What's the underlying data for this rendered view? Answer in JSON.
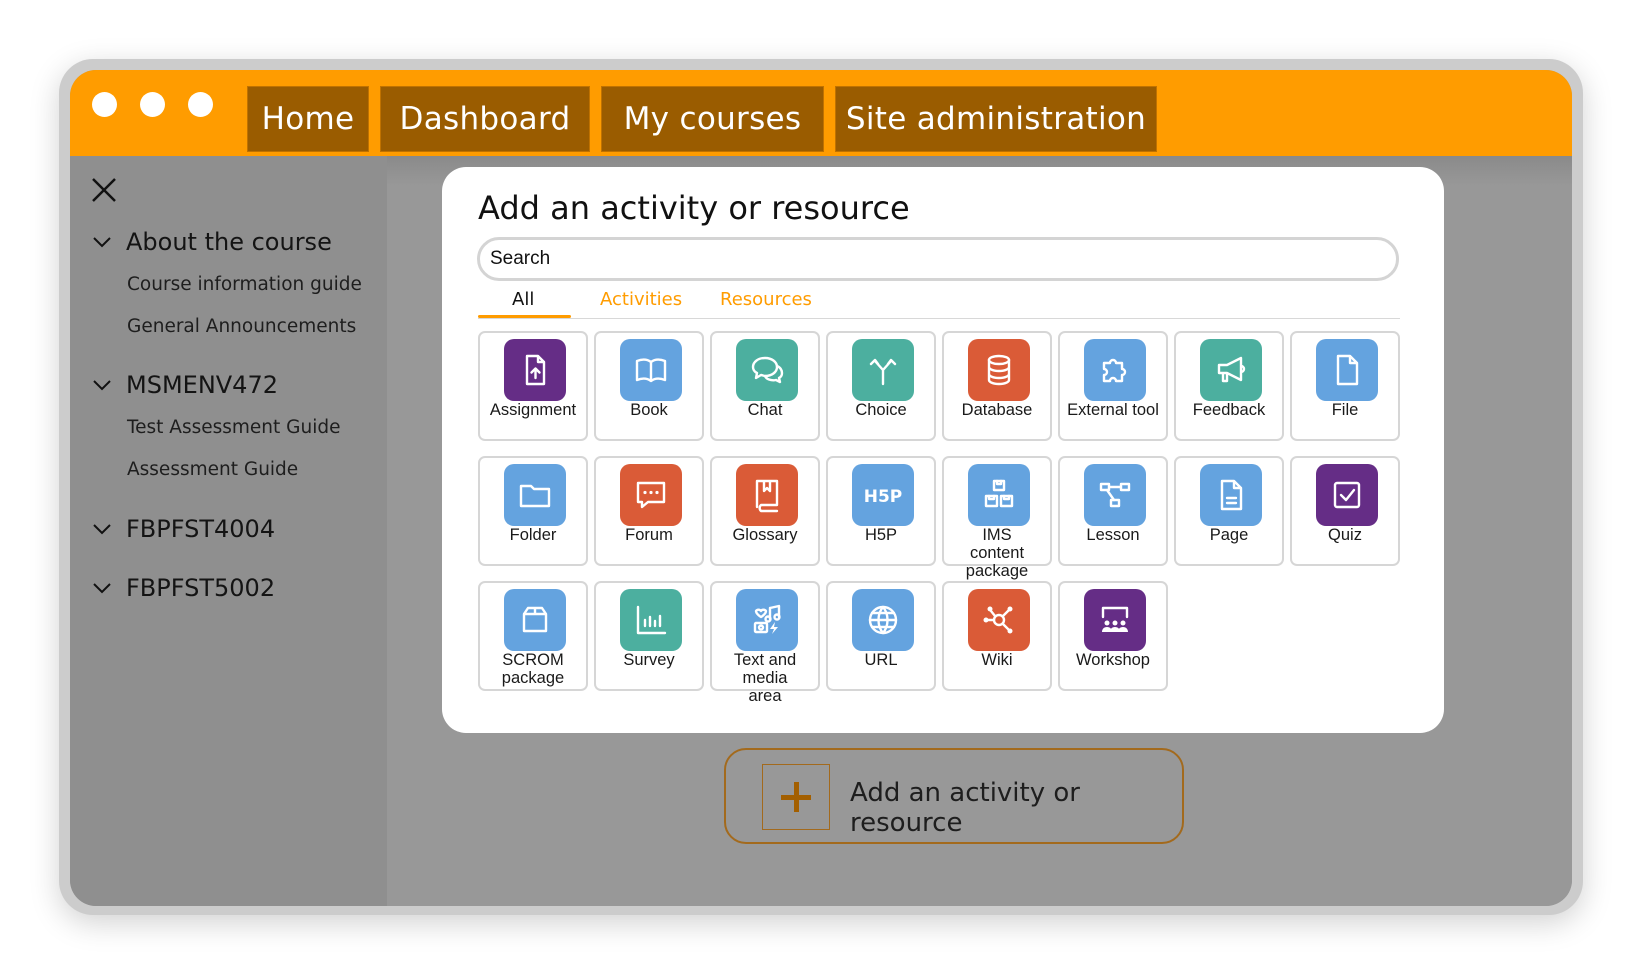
{
  "window": {
    "nav_tabs": [
      {
        "label": "Home"
      },
      {
        "label": "Dashboard"
      },
      {
        "label": "My courses"
      },
      {
        "label": "Site administration"
      }
    ]
  },
  "sidebar": {
    "close_icon": "close-icon",
    "sections": [
      {
        "title": "About the course",
        "items": [
          "Course information guide",
          "General Announcements"
        ]
      },
      {
        "title": "MSMENV472",
        "items": [
          "Test Assessment Guide",
          "Assessment Guide"
        ]
      },
      {
        "title": "FBPFST4004",
        "items": []
      },
      {
        "title": "FBPFST5002",
        "items": []
      }
    ]
  },
  "modal": {
    "title": "Add an activity or resource",
    "search_placeholder": "Search",
    "search_value": "",
    "tabs": [
      {
        "label": "All",
        "active": true
      },
      {
        "label": "Activities",
        "active": false
      },
      {
        "label": "Resources",
        "active": false
      }
    ],
    "items": [
      {
        "label": "Assignment",
        "icon": "assignment-icon",
        "color": "#652d86"
      },
      {
        "label": "Book",
        "icon": "book-icon",
        "color": "#64a3df"
      },
      {
        "label": "Chat",
        "icon": "chat-icon",
        "color": "#4caf9f"
      },
      {
        "label": "Choice",
        "icon": "choice-icon",
        "color": "#4caf9f"
      },
      {
        "label": "Database",
        "icon": "database-icon",
        "color": "#da5b37"
      },
      {
        "label": "External tool",
        "icon": "puzzle-icon",
        "color": "#64a3df"
      },
      {
        "label": "Feedback",
        "icon": "megaphone-icon",
        "color": "#4caf9f"
      },
      {
        "label": "File",
        "icon": "file-icon",
        "color": "#64a3df"
      },
      {
        "label": "Folder",
        "icon": "folder-icon",
        "color": "#64a3df"
      },
      {
        "label": "Forum",
        "icon": "forum-icon",
        "color": "#da5b37"
      },
      {
        "label": "Glossary",
        "icon": "glossary-icon",
        "color": "#da5b37"
      },
      {
        "label": "H5P",
        "icon": "h5p-icon",
        "color": "#64a3df"
      },
      {
        "label": "IMS content package",
        "icon": "ims-package-icon",
        "color": "#64a3df"
      },
      {
        "label": "Lesson",
        "icon": "lesson-icon",
        "color": "#64a3df"
      },
      {
        "label": "Page",
        "icon": "page-icon",
        "color": "#64a3df"
      },
      {
        "label": "Quiz",
        "icon": "quiz-icon",
        "color": "#652d86"
      },
      {
        "label": "SCROM package",
        "icon": "scorm-icon",
        "color": "#64a3df"
      },
      {
        "label": "Survey",
        "icon": "survey-icon",
        "color": "#4caf9f"
      },
      {
        "label": "Text and media area",
        "icon": "text-media-icon",
        "color": "#64a3df"
      },
      {
        "label": "URL",
        "icon": "url-globe-icon",
        "color": "#64a3df"
      },
      {
        "label": "Wiki",
        "icon": "wiki-icon",
        "color": "#da5b37"
      },
      {
        "label": "Workshop",
        "icon": "workshop-icon",
        "color": "#652d86"
      }
    ]
  },
  "main": {
    "add_button_label": "Add an activity or resource"
  },
  "colors": {
    "accent": "#ff9c00",
    "nav_tab_bg": "#9a5c00",
    "sidebar_bg": "#8f8f8f",
    "main_bg": "#989898"
  }
}
